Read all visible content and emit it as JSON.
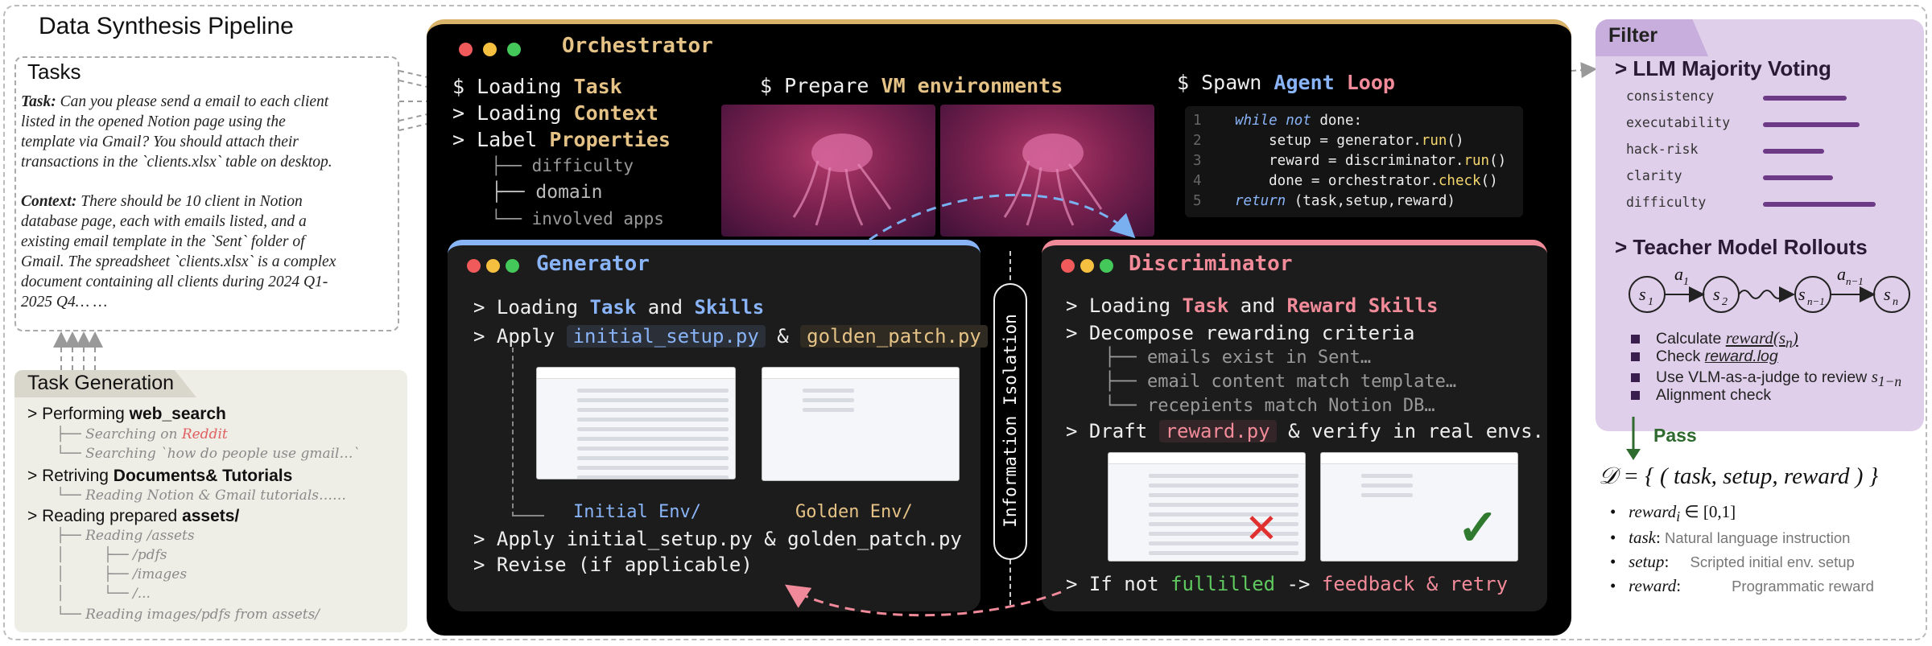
{
  "title": "Data Synthesis Pipeline",
  "tasks": {
    "header": "Tasks",
    "task_label": "Task:",
    "task_lines": [
      "Can you please send a email to each client",
      "listed in the opened Notion page using the",
      "template via Gmail? You should attach their",
      "transactions in the `clients.xlsx` table on desktop."
    ],
    "context_label": "Context:",
    "context_lines": [
      "There should be 10 client in Notion",
      "database page, each with emails listed, and a",
      "existing email template in the `Sent` folder of",
      "Gmail. The spreadsheet `clients.xlsx` is a complex",
      "document containing all clients during 2024 Q1-",
      "2025 Q4… …"
    ]
  },
  "task_generation": {
    "header": "Task Generation",
    "l1_pre": "> Performing ",
    "l1_bold": "web_search",
    "s1_pre": "├── Searching on ",
    "s1_red": "Reddit",
    "s2": "└── Searching `how do people use gmail…`",
    "l2_pre": "> Retriving ",
    "l2_bold": "Documents& Tutorials",
    "s3": "└── Reading Notion & Gmail tutorials……",
    "l3_pre": "> Reading prepared ",
    "l3_bold": "assets/",
    "s4": "├── Reading /assets",
    "s5": "│         ├── /pdfs",
    "s6": "│         ├── /images",
    "s7": "│         └── /...",
    "s8": "└── Reading images/pdfs from assets/"
  },
  "orchestrator": {
    "title": "Orchestrator",
    "l1_pre": "$ Loading ",
    "l1_hl": "Task",
    "l2_pre": "> Loading ",
    "l2_hl": "Context",
    "l3_pre": "> Label ",
    "l3_hl": "Properties",
    "t1": "├── difficulty",
    "t2": "├── domain",
    "t3": "└── involved apps",
    "vm_pre": "$ Prepare ",
    "vm_hl": "VM environments",
    "spawn_pre": "$ Spawn ",
    "spawn_hl1": "Agent",
    "spawn_hl2": "Loop",
    "code": [
      {
        "n": "1",
        "parts": [
          [
            "kw",
            "while "
          ],
          [
            "kw",
            "not"
          ],
          [
            "t",
            " done:"
          ]
        ]
      },
      {
        "n": "2",
        "parts": [
          [
            "t",
            "    setup = generator."
          ],
          [
            "fn",
            "run"
          ],
          [
            "t",
            "()"
          ]
        ]
      },
      {
        "n": "3",
        "parts": [
          [
            "t",
            "    reward = discriminator."
          ],
          [
            "fn",
            "run"
          ],
          [
            "t",
            "()"
          ]
        ]
      },
      {
        "n": "4",
        "parts": [
          [
            "t",
            "    done = orchestrator."
          ],
          [
            "fn",
            "check"
          ],
          [
            "t",
            "()"
          ]
        ]
      },
      {
        "n": "5",
        "parts": [
          [
            "kw",
            "return "
          ],
          [
            "t",
            "(task,setup,reward)"
          ]
        ]
      }
    ]
  },
  "generator": {
    "title": "Generator",
    "l1_pre": "> Loading ",
    "l1_hl1": "Task",
    "l1_mid": " and ",
    "l1_hl2": "Skills",
    "l2_pre": "> Apply ",
    "chip1": "initial_setup.py",
    "amp": "&",
    "chip2": "golden_patch.py",
    "env1": "Initial Env/",
    "env2": "Golden Env/",
    "l3": "> Apply initial_setup.py & golden_patch.py",
    "l4": "> Revise (if applicable)"
  },
  "isolation": "Information Isolation",
  "discriminator": {
    "title": "Discriminator",
    "l1_pre": "> Loading ",
    "l1_hl1": "Task",
    "l1_mid": " and ",
    "l1_hl2": "Reward Skills",
    "l2": "> Decompose rewarding criteria",
    "t1": "├── emails exist in Sent…",
    "t2": "├── email content match template…",
    "t3": "└── recepients match Notion DB…",
    "l3_pre": "> Draft ",
    "chip": "reward.py",
    "l3_post": " & verify in real envs.",
    "l4_pre": "> If not ",
    "l4_green": "fullilled",
    "l4_mid": " -> ",
    "l4_red": "feedback & retry"
  },
  "filter": {
    "tab": "Filter",
    "h1": "> LLM Majority Voting",
    "metrics": [
      {
        "label": "consistency",
        "value": 0.74
      },
      {
        "label": "executability",
        "value": 0.86
      },
      {
        "label": "hack-risk",
        "value": 0.54
      },
      {
        "label": "clarity",
        "value": 0.62
      },
      {
        "label": "difficulty",
        "value": 1.2
      }
    ],
    "h2": "> Teacher Model Rollouts",
    "b1_pre": "Calculate ",
    "b1_it": "reward(s",
    "b1_sub": "n",
    "b2_pre": "Check ",
    "b2_it": "reward.log",
    "b3_pre": "Use VLM-as-a-judge to review ",
    "b3_it": "s",
    "b3_sub": "1−n",
    "b4": "Alignment check"
  },
  "pass": "Pass",
  "dataset": {
    "eq": "𝒟 = { ( task, setup, reward ) }",
    "d1_it": "reward",
    "d1_sub": "i",
    "d1_post": " ∈ [0,1]",
    "d2_it": "task",
    "d2_colon": ":",
    "d2_gray": "Natural language instruction",
    "d3_it": "setup",
    "d3_colon": ":",
    "d3_gray": "Scripted initial env. setup",
    "d4_it": "reward",
    "d4_colon": ":",
    "d4_gray": "Programmatic reward"
  }
}
